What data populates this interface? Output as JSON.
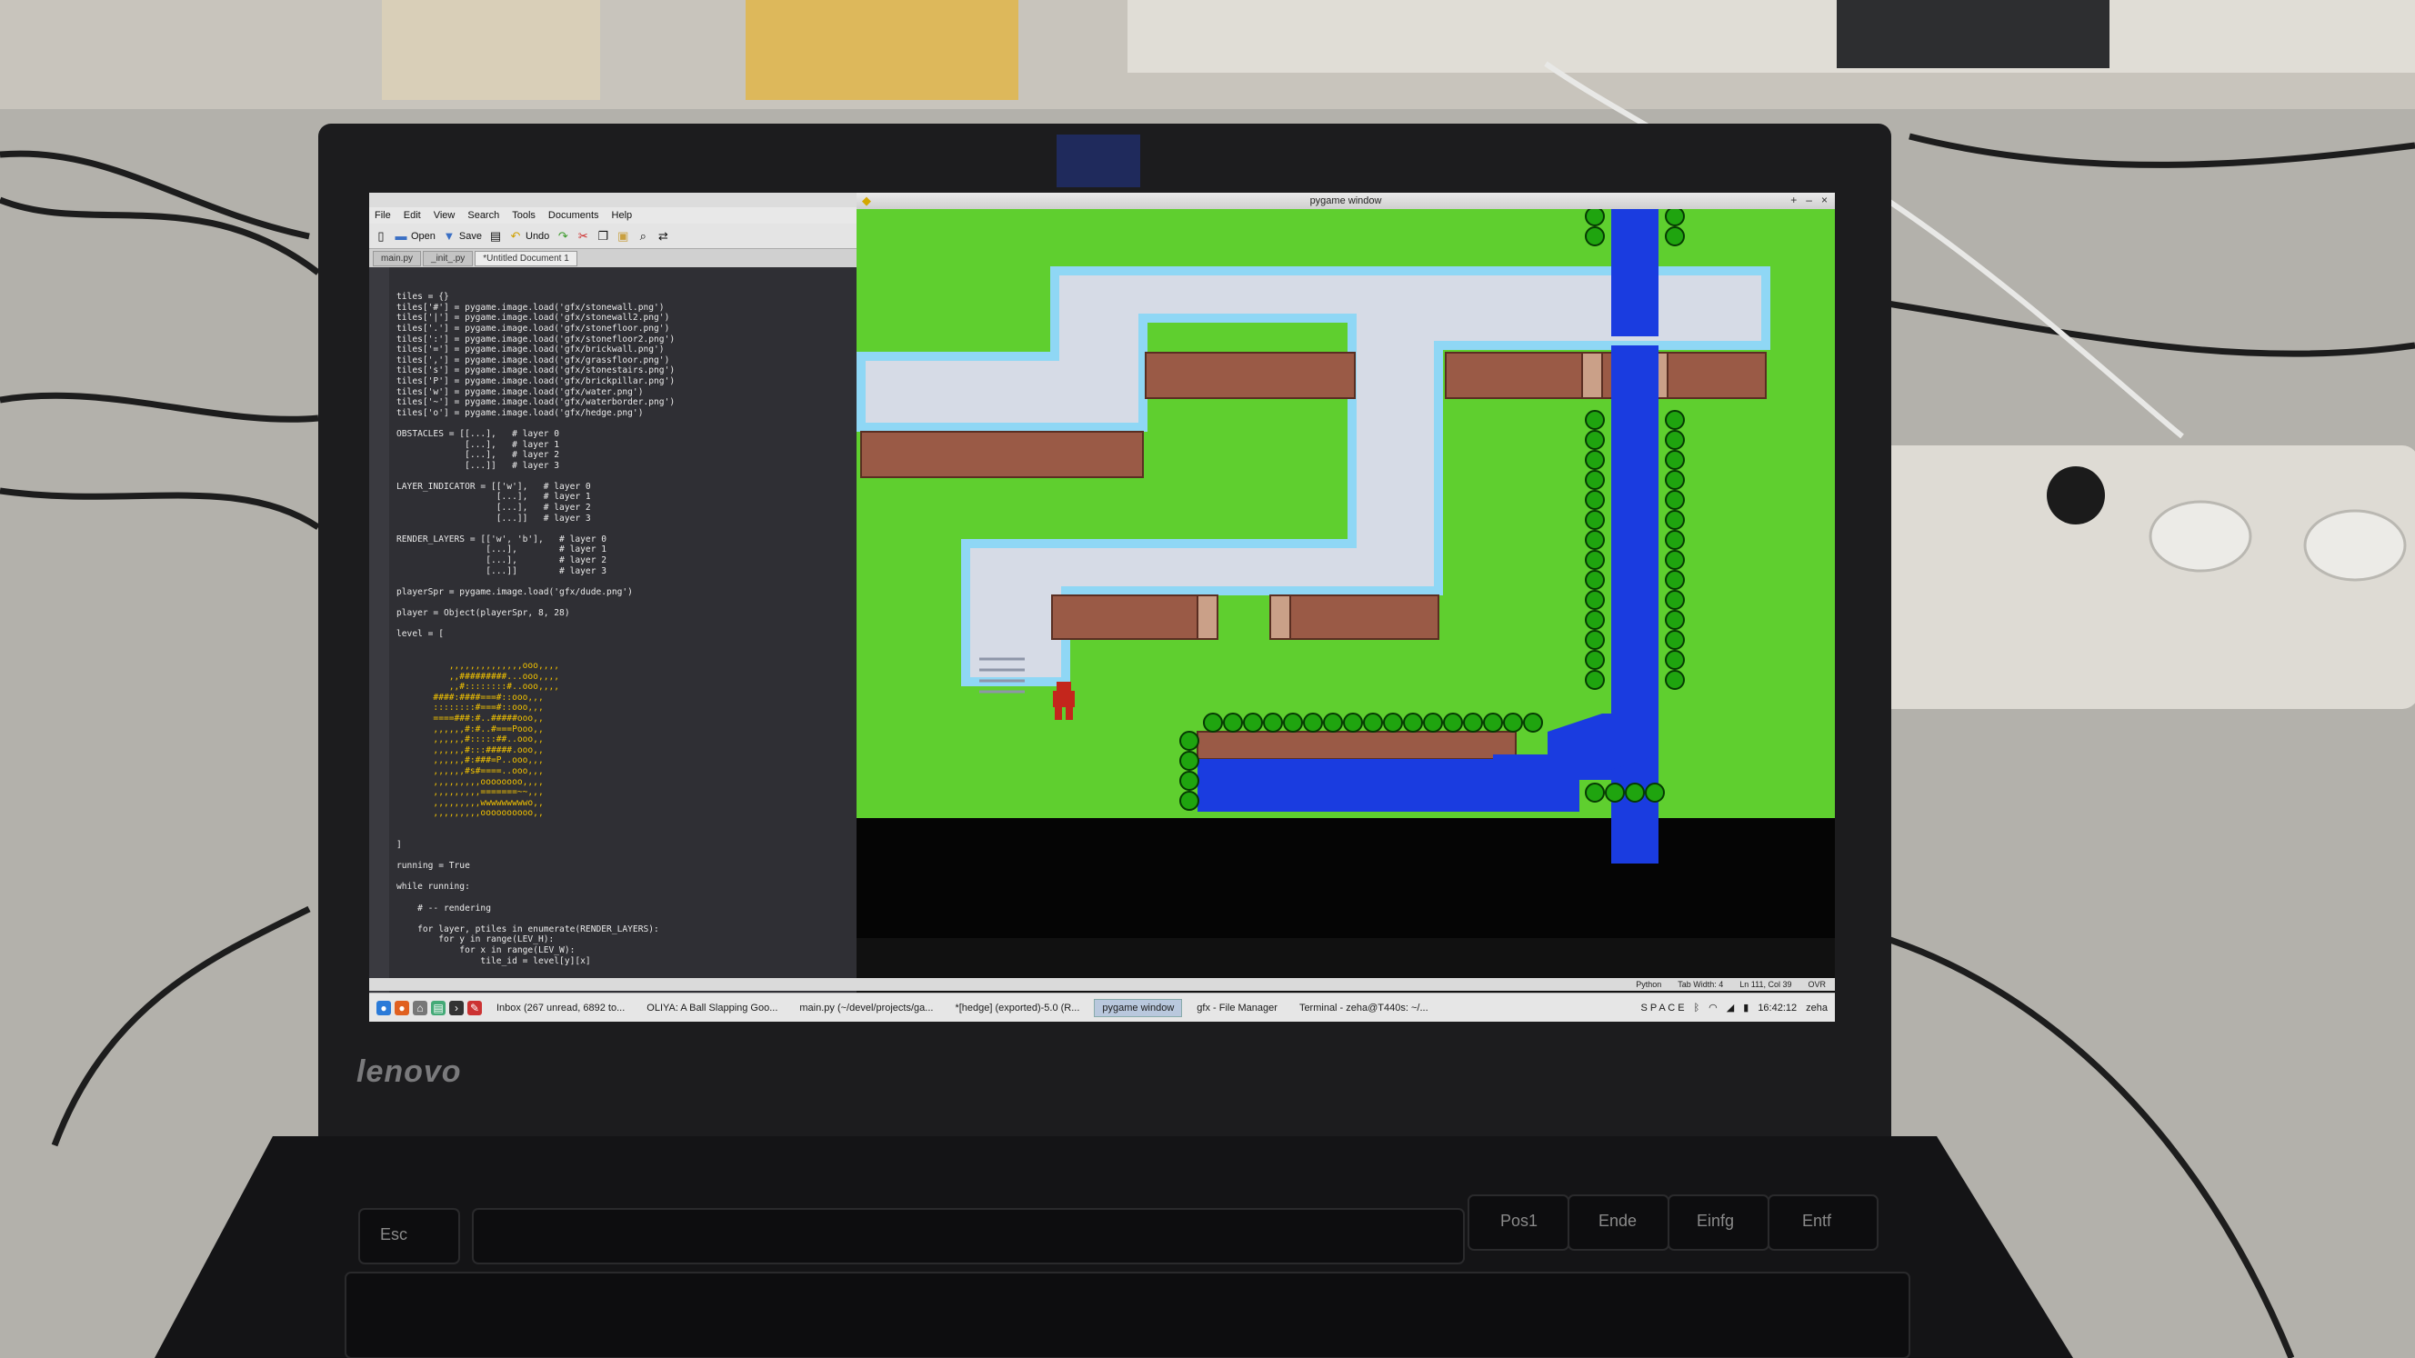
{
  "editor": {
    "menu": [
      "File",
      "Edit",
      "View",
      "Search",
      "Tools",
      "Documents",
      "Help"
    ],
    "toolbar": {
      "open": "Open",
      "save": "Save",
      "undo": "Undo"
    },
    "tabs": [
      "main.py",
      "_init_.py",
      "*Untitled Document 1"
    ],
    "code_top": "tiles = {}\ntiles['#'] = pygame.image.load('gfx/stonewall.png')\ntiles['|'] = pygame.image.load('gfx/stonewall2.png')\ntiles['.'] = pygame.image.load('gfx/stonefloor.png')\ntiles[':'] = pygame.image.load('gfx/stonefloor2.png')\ntiles['='] = pygame.image.load('gfx/brickwall.png')\ntiles[','] = pygame.image.load('gfx/grassfloor.png')\ntiles['s'] = pygame.image.load('gfx/stonestairs.png')\ntiles['P'] = pygame.image.load('gfx/brickpillar.png')\ntiles['w'] = pygame.image.load('gfx/water.png')\ntiles['~'] = pygame.image.load('gfx/waterborder.png')\ntiles['o'] = pygame.image.load('gfx/hedge.png')\n\nOBSTACLES = [[...],   # layer 0\n             [...],   # layer 1\n             [...],   # layer 2\n             [...]]   # layer 3\n\nLAYER_INDICATOR = [['w'],   # layer 0\n                   [...],   # layer 1\n                   [...],   # layer 2\n                   [...]]   # layer 3\n\nRENDER_LAYERS = [['w', 'b'],   # layer 0\n                 [...],        # layer 1\n                 [...],        # layer 2\n                 [...]]        # layer 3\n\nplayerSpr = pygame.image.load('gfx/dude.png')\n\nplayer = Object(playerSpr, 8, 28)\n\nlevel = [",
    "code_bottom": "]\n\nrunning = True\n\nwhile running:\n\n    # -- rendering\n\n    for layer, ptiles in enumerate(RENDER_LAYERS):\n        for y in range(LEV_H):\n            for x in range(LEV_W):\n                tile_id = level[y][x]"
  },
  "game": {
    "title": "pygame window",
    "controls": [
      "+",
      "–",
      "×"
    ]
  },
  "statusbar": {
    "language": "Python",
    "tab_width": "Tab Width: 4",
    "position": "Ln 111, Col 39",
    "mode": "OVR"
  },
  "taskbar": {
    "tasks": [
      "Inbox (267 unread, 6892 to...",
      "OLIYA: A Ball Slapping Goo...",
      "main.py (~/devel/projects/ga...",
      "*[hedge] (exported)-5.0 (R...",
      "pygame window",
      "gfx - File Manager",
      "Terminal - zeha@T440s: ~/..."
    ],
    "active_task": 4,
    "keyboard": "S P A C E",
    "clock": "16:42:12",
    "user": "zeha"
  },
  "laptop": {
    "brand": "lenovo",
    "keys": [
      "Esc",
      "Pos1",
      "Ende",
      "Einfg",
      "Entf"
    ]
  },
  "colors": {
    "grass": "#5fcf2f",
    "stone_floor": "#d6dbe6",
    "stone_border": "#8fd7f5",
    "brick": "#9a5a46",
    "water": "#1a3ce0",
    "hedge": "#1fa40f",
    "player": "#c4261c"
  }
}
